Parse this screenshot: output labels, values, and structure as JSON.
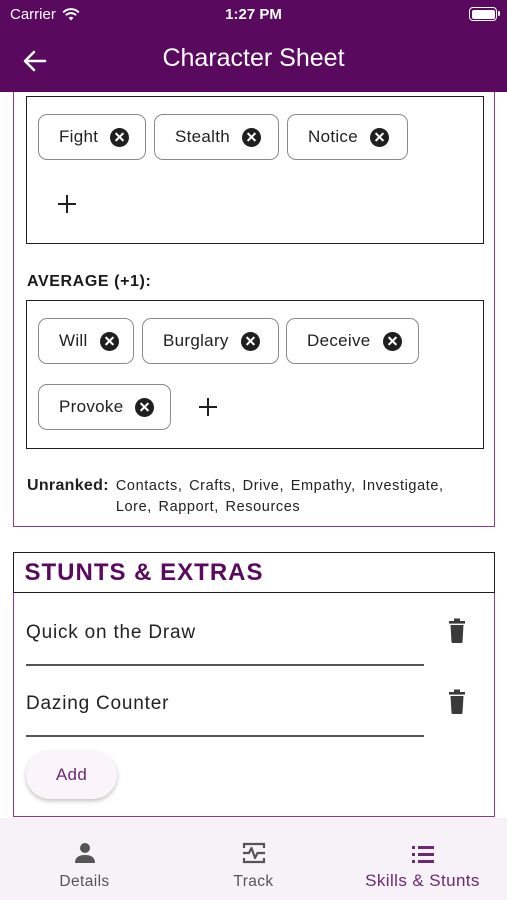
{
  "status_bar": {
    "carrier": "Carrier",
    "time": "1:27 PM"
  },
  "app_bar": {
    "title": "Character Sheet"
  },
  "skills": {
    "top_group": {
      "chips": [
        "Fight",
        "Stealth",
        "Notice"
      ]
    },
    "average_group": {
      "label": "AVERAGE (+1):",
      "chips": [
        "Will",
        "Burglary",
        "Deceive",
        "Provoke"
      ]
    },
    "unranked": {
      "label": "Unranked:",
      "list": "Contacts,  Crafts,  Drive,  Empathy,  Investigate,  Lore,  Rapport,  Resources"
    }
  },
  "stunts": {
    "header": "STUNTS & EXTRAS",
    "items": [
      "Quick on the Draw",
      "Dazing Counter"
    ],
    "add_label": "Add"
  },
  "bottom_nav": {
    "items": [
      {
        "label": "Details",
        "icon": "person-icon"
      },
      {
        "label": "Track",
        "icon": "track-icon"
      },
      {
        "label": "Skills & Stunts",
        "icon": "list-icon"
      }
    ],
    "active_index": 2
  },
  "colors": {
    "primary": "#5a0a5e",
    "accent": "#6b2a70",
    "card_border": "#8a3d8f",
    "nav_bg": "#f7f2f7"
  }
}
